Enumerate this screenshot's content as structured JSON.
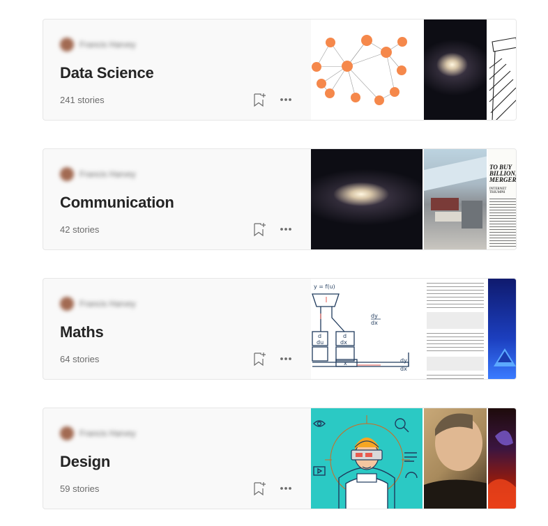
{
  "lists": [
    {
      "author": "Francis Harvey",
      "title": "Data Science",
      "count": "241 stories"
    },
    {
      "author": "Francis Harvey",
      "title": "Communication",
      "count": "42 stories"
    },
    {
      "author": "Francis Harvey",
      "title": "Maths",
      "count": "64 stories"
    },
    {
      "author": "Francis Harvey",
      "title": "Design",
      "count": "59 stories"
    }
  ],
  "thumbnails": {
    "maths_diagram": {
      "top_eq": "y = f(u)",
      "frac_top": "dy",
      "frac_bottom": "dx",
      "d": "d",
      "du": "du",
      "dx": "dx",
      "x": "x"
    },
    "newspaper": {
      "line1": "TO BUY",
      "line2": "BILLION;",
      "line3": "MERGER",
      "sub": "INTERNET TRIUMPH"
    }
  },
  "icons": {
    "save": "bookmark-plus-icon",
    "more": "more-horizontal-icon"
  },
  "colors": {
    "accent_orange": "#f5884b",
    "teal": "#2bc9c4",
    "card_bg": "#f9f9f9"
  }
}
